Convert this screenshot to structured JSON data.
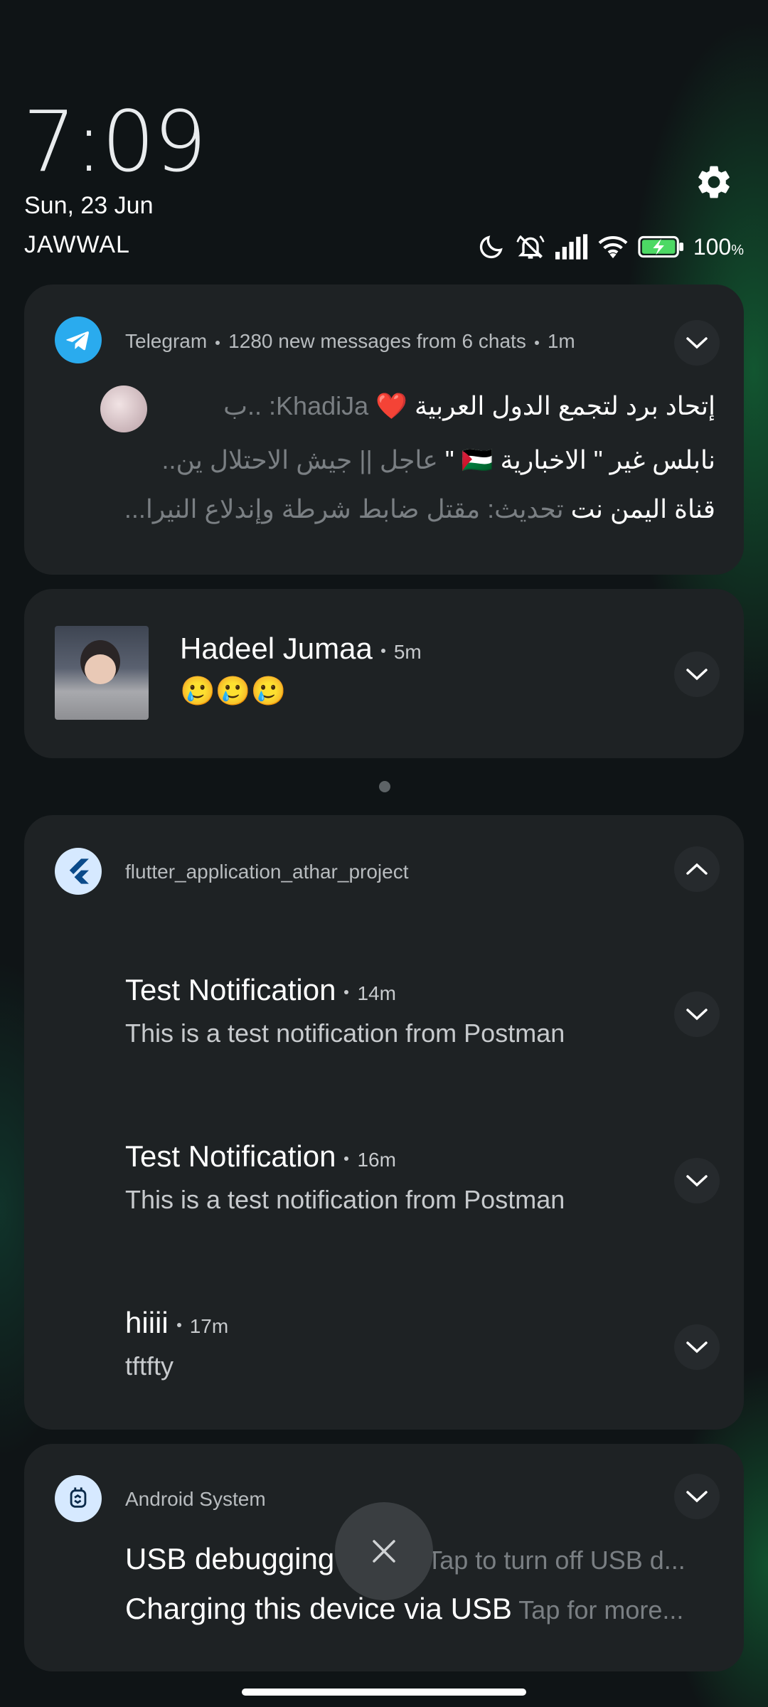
{
  "header": {
    "time": "7:09",
    "date": "Sun, 23 Jun",
    "carrier": "JAWWAL",
    "battery": "100",
    "battery_unit": "%"
  },
  "icons": {
    "settings": "gear-icon",
    "status": [
      "moon-icon",
      "silent-bell-icon",
      "signal-icon",
      "wifi-icon",
      "battery-charging-icon"
    ]
  },
  "colors": {
    "telegram": "#2AABEE",
    "battery": "#4cd964",
    "heart": "#e01b24"
  },
  "telegram": {
    "app": "Telegram",
    "summary": "1280 new messages from 6 chats",
    "time": "1m",
    "rows": [
      {
        "title": "إتحاد برد لتجمع الدول العربية ❤️",
        "sender": "KhadiJa: ..ب"
      },
      {
        "title": "نابلس غير \" الاخبارية 🇵🇸 \"",
        "preview": "عاجل || جيش الاحتلال ين.."
      },
      {
        "title": "قناة اليمن نت",
        "preview": "تحديث: مقتل ضابط شرطة وإندلاع النيرا..."
      }
    ]
  },
  "hadeel": {
    "name": "Hadeel Jumaa",
    "time": "5m",
    "message": "🥲🥲🥲"
  },
  "flutter": {
    "app": "flutter_application_athar_project",
    "items": [
      {
        "title": "Test Notification",
        "time": "14m",
        "body": "This is a test notification from Postman"
      },
      {
        "title": "Test Notification",
        "time": "16m",
        "body": "This is a test notification from Postman"
      },
      {
        "title": "hiiii",
        "time": "17m",
        "body": "tftfty"
      }
    ]
  },
  "android": {
    "app": "Android System",
    "rows": [
      {
        "title": "USB debugging",
        "sub": "Tap to turn off USB d..."
      },
      {
        "title": "Charging this device via USB",
        "sub": "Tap for more..."
      }
    ]
  }
}
